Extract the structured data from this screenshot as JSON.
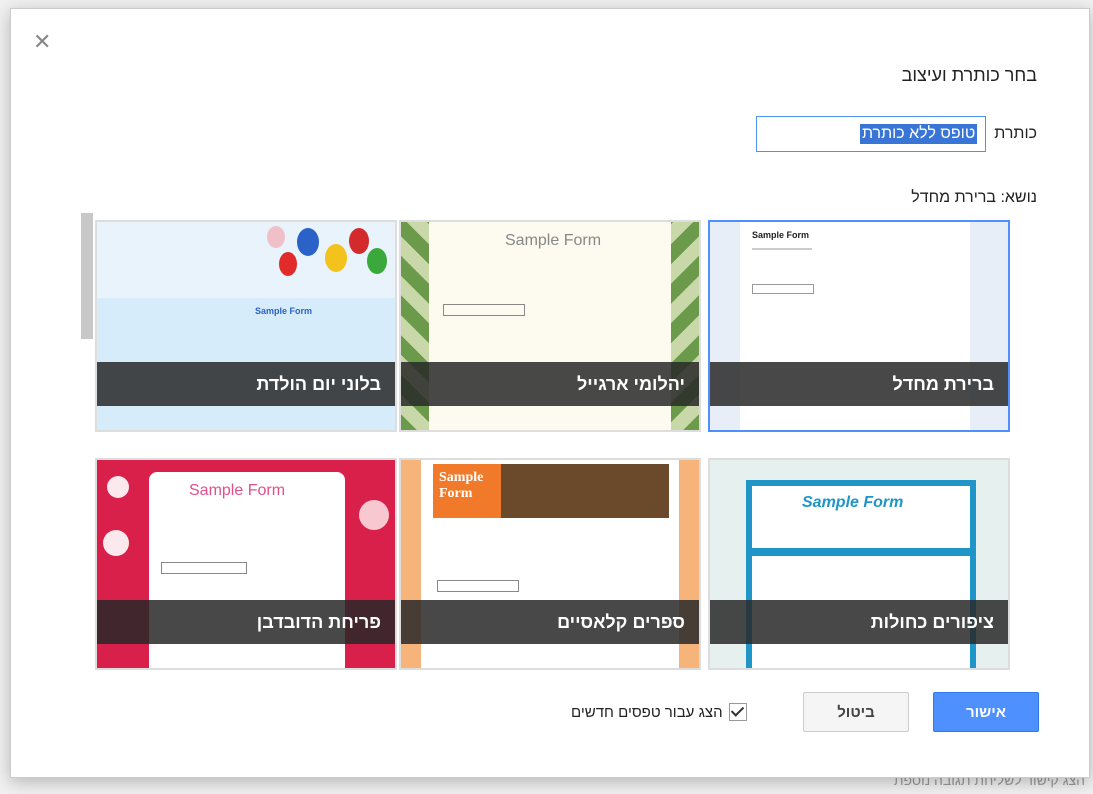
{
  "dialog": {
    "heading": "בחר כותרת ועיצוב",
    "title_label": "כותרת",
    "title_value": "טופס ללא כותרת",
    "theme_label": "נושא: ברירת מחדל",
    "themes": [
      {
        "name": "ברירת מחדל",
        "selected": true,
        "preview_title": "Sample Form"
      },
      {
        "name": "יהלומי ארגייל",
        "selected": false,
        "preview_title": "Sample Form"
      },
      {
        "name": "בלוני יום הולדת",
        "selected": false,
        "preview_title": "Sample Form"
      },
      {
        "name": "ציפורים כחולות",
        "selected": false,
        "preview_title": "Sample Form"
      },
      {
        "name": "ספרים קלאסיים",
        "selected": false,
        "preview_title": "Sample Form"
      },
      {
        "name": "פריחת הדובדבן",
        "selected": false,
        "preview_title": "Sample Form"
      }
    ],
    "ok_label": "אישור",
    "cancel_label": "ביטול",
    "show_for_new_label": "הצג עבור טפסים חדשים",
    "close_glyph": "✕"
  },
  "background": {
    "hint_text": "הצג קישור לשליחת תגובה נוספת"
  },
  "colors": {
    "accent": "#4d90fe",
    "selected_tile_border": "#4d90fe"
  }
}
